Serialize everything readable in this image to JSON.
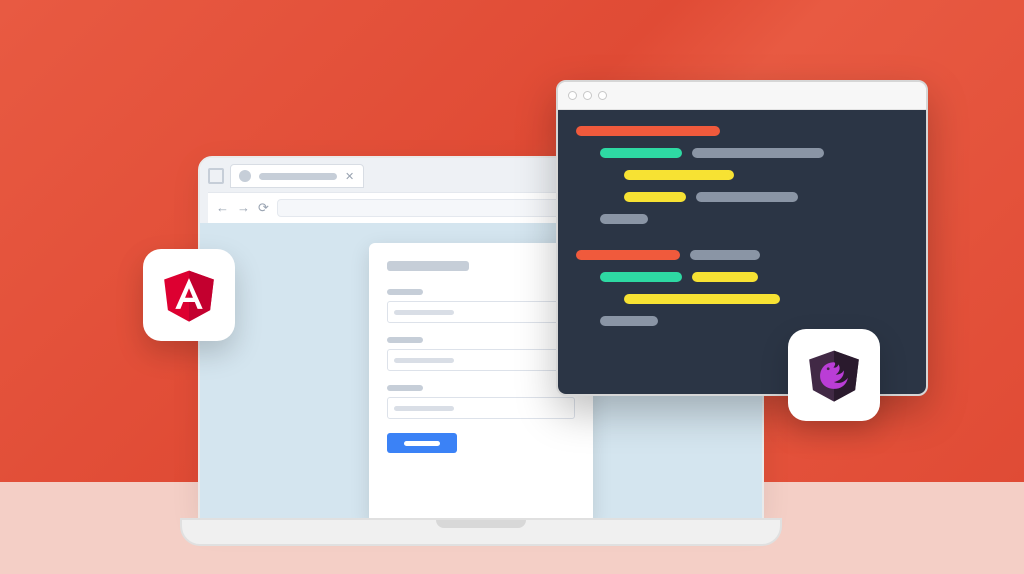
{
  "illustration": {
    "description": "Stylized illustration of a laptop showing a browser with a form, overlaid by a code editor window, flanked by Angular and NgRx logo cards",
    "colors": {
      "background_top": "#e85a42",
      "background_bottom": "#f4cfc6",
      "browser_viewport": "#d4e5ef",
      "editor_bg": "#2b3545",
      "submit_button": "#3b82f6"
    },
    "logos": [
      "Angular",
      "NgRx"
    ]
  }
}
